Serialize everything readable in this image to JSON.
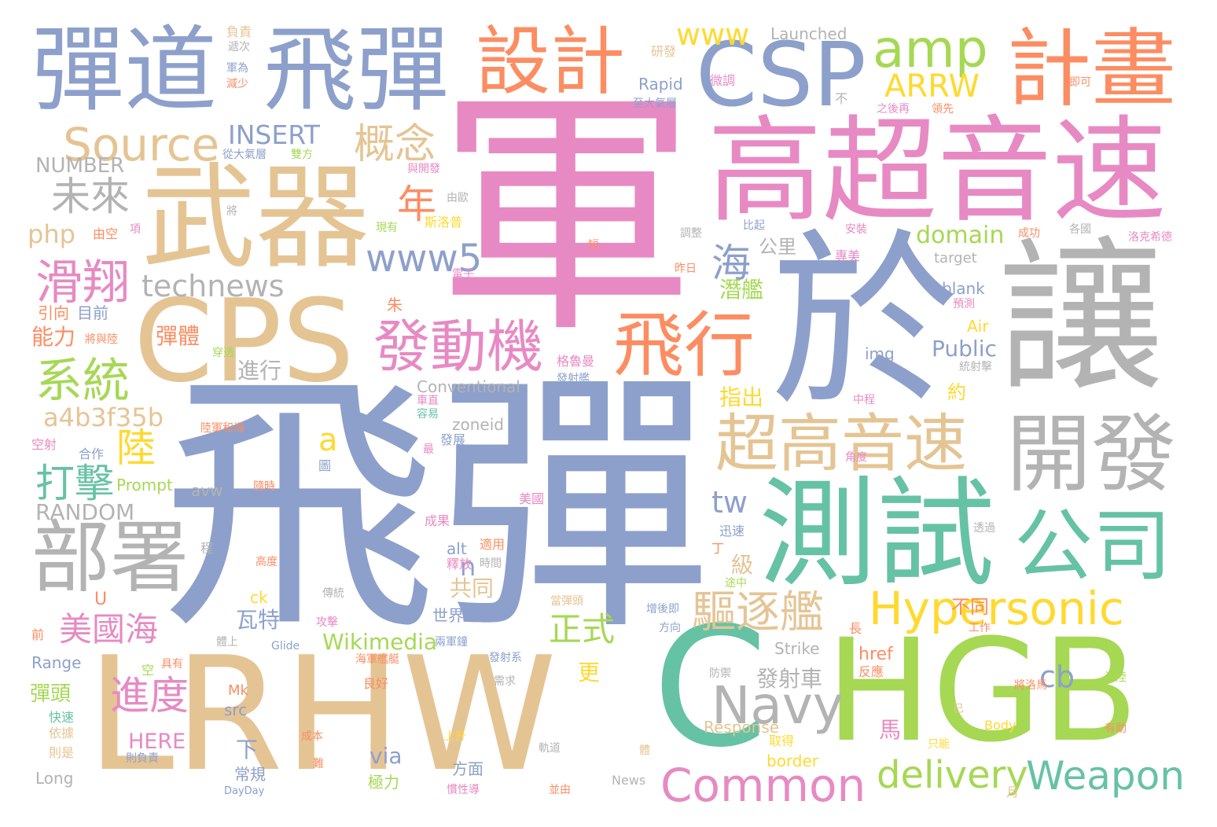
{
  "palette": {
    "blue": "#8da0cb",
    "pink": "#e78ac3",
    "green": "#a6d854",
    "orange": "#fc8d62",
    "tan": "#e5c494",
    "gray": "#b3b3b3",
    "teal": "#66c2a5",
    "yellow": "#ffd92f"
  },
  "words": [
    {
      "id": "w01",
      "text": "軍",
      "color": "pink"
    },
    {
      "id": "w02",
      "text": "飛彈",
      "color": "blue"
    },
    {
      "id": "w03",
      "text": "LRHW",
      "color": "tan"
    },
    {
      "id": "w04",
      "text": "C",
      "color": "teal"
    },
    {
      "id": "w05",
      "text": "HGB",
      "color": "green"
    },
    {
      "id": "w06",
      "text": "讓",
      "color": "gray"
    },
    {
      "id": "w07",
      "text": "於",
      "color": "blue"
    },
    {
      "id": "w08",
      "text": "高超音速",
      "color": "pink"
    },
    {
      "id": "w09",
      "text": "武器",
      "color": "tan"
    },
    {
      "id": "w10",
      "text": "CPS",
      "color": "tan"
    },
    {
      "id": "w11",
      "text": "測試",
      "color": "teal"
    },
    {
      "id": "w12",
      "text": "飛彈",
      "color": "blue"
    },
    {
      "id": "w13",
      "text": "彈道",
      "color": "blue"
    },
    {
      "id": "w14",
      "text": "CSP",
      "color": "blue"
    },
    {
      "id": "w15",
      "text": "計畫",
      "color": "orange"
    },
    {
      "id": "w16",
      "text": "設計",
      "color": "orange"
    },
    {
      "id": "w17",
      "text": "開發",
      "color": "gray"
    },
    {
      "id": "w18",
      "text": "部署",
      "color": "gray"
    },
    {
      "id": "w19",
      "text": "超高音速",
      "color": "tan"
    },
    {
      "id": "w20",
      "text": "公司",
      "color": "teal"
    },
    {
      "id": "w21",
      "text": "飛行",
      "color": "orange"
    },
    {
      "id": "w22",
      "text": "發動機",
      "color": "pink"
    },
    {
      "id": "w23",
      "text": "amp",
      "color": "green"
    },
    {
      "id": "w24",
      "text": "Navy",
      "color": "gray"
    },
    {
      "id": "w25",
      "text": "Hypersonic",
      "color": "yellow"
    },
    {
      "id": "w26",
      "text": "Common",
      "color": "pink"
    },
    {
      "id": "w27",
      "text": "Weapon",
      "color": "teal"
    },
    {
      "id": "w28",
      "text": "delivery",
      "color": "green"
    },
    {
      "id": "w29",
      "text": "Source",
      "color": "tan"
    },
    {
      "id": "w30",
      "text": "滑翔",
      "color": "pink"
    },
    {
      "id": "w31",
      "text": "系統",
      "color": "green"
    },
    {
      "id": "w32",
      "text": "驅逐艦",
      "color": "tan"
    },
    {
      "id": "w33",
      "text": "概念",
      "color": "tan"
    },
    {
      "id": "w34",
      "text": "未來",
      "color": "gray"
    },
    {
      "id": "w35",
      "text": "www5",
      "color": "blue"
    },
    {
      "id": "w36",
      "text": "ARRW",
      "color": "yellow"
    },
    {
      "id": "w37",
      "text": "www",
      "color": "yellow"
    },
    {
      "id": "w38",
      "text": "technews",
      "color": "gray"
    },
    {
      "id": "w39",
      "text": "INSERT",
      "color": "blue"
    },
    {
      "id": "w40",
      "text": "NUMBER",
      "color": "gray"
    },
    {
      "id": "w41",
      "text": "RANDOM",
      "color": "gray"
    },
    {
      "id": "w42",
      "text": "php",
      "color": "tan"
    },
    {
      "id": "w43",
      "text": "a4b3f35b",
      "color": "tan"
    },
    {
      "id": "w44",
      "text": "年",
      "color": "orange"
    },
    {
      "id": "w45",
      "text": "海",
      "color": "blue"
    },
    {
      "id": "w46",
      "text": "陸",
      "color": "yellow"
    },
    {
      "id": "w47",
      "text": "打擊",
      "color": "teal"
    },
    {
      "id": "w48",
      "text": "美國海",
      "color": "pink"
    },
    {
      "id": "w49",
      "text": "進度",
      "color": "pink"
    },
    {
      "id": "w50",
      "text": "正式",
      "color": "green"
    },
    {
      "id": "w51",
      "text": "domain",
      "color": "green"
    },
    {
      "id": "w52",
      "text": "tw",
      "color": "blue"
    },
    {
      "id": "w53",
      "text": "cb",
      "color": "blue"
    },
    {
      "id": "w54",
      "text": "Wikimedia",
      "color": "green"
    },
    {
      "id": "w55",
      "text": "Public",
      "color": "blue"
    },
    {
      "id": "w56",
      "text": "a",
      "color": "yellow"
    },
    {
      "id": "w57",
      "text": "n",
      "color": "blue"
    },
    {
      "id": "w58",
      "text": "via",
      "color": "blue"
    },
    {
      "id": "w59",
      "text": "HERE",
      "color": "pink"
    },
    {
      "id": "w60",
      "text": "Conventional",
      "color": "gray"
    },
    {
      "id": "w61",
      "text": "zoneid",
      "color": "gray"
    },
    {
      "id": "w62",
      "text": "Prompt",
      "color": "green"
    },
    {
      "id": "w63",
      "text": "Launched",
      "color": "gray"
    },
    {
      "id": "w64",
      "text": "Rapid",
      "color": "blue"
    },
    {
      "id": "w65",
      "text": "指出",
      "color": "yellow"
    },
    {
      "id": "w66",
      "text": "潛艦",
      "color": "green"
    },
    {
      "id": "w67",
      "text": "公里",
      "color": "gray"
    },
    {
      "id": "w68",
      "text": "發射車",
      "color": "gray"
    },
    {
      "id": "w69",
      "text": "瓦特",
      "color": "blue"
    },
    {
      "id": "w70",
      "text": "共同",
      "color": "tan"
    },
    {
      "id": "w71",
      "text": "級",
      "color": "tan"
    },
    {
      "id": "w72",
      "text": "彈體",
      "color": "orange"
    },
    {
      "id": "w73",
      "text": "能力",
      "color": "orange"
    },
    {
      "id": "w74",
      "text": "進行",
      "color": "gray"
    },
    {
      "id": "w75",
      "text": "更",
      "color": "yellow"
    },
    {
      "id": "w76",
      "text": "下",
      "color": "blue"
    },
    {
      "id": "w77",
      "text": "馬",
      "color": "pink"
    },
    {
      "id": "w78",
      "text": "不同",
      "color": "orange"
    },
    {
      "id": "w79",
      "text": "彈頭",
      "color": "green"
    },
    {
      "id": "w80",
      "text": "目前",
      "color": "blue"
    },
    {
      "id": "w81",
      "text": "引向",
      "color": "orange"
    },
    {
      "id": "w82",
      "text": "世界",
      "color": "blue"
    },
    {
      "id": "w83",
      "text": "方面",
      "color": "blue"
    },
    {
      "id": "w84",
      "text": "極力",
      "color": "green"
    },
    {
      "id": "w85",
      "text": "src",
      "color": "blue"
    },
    {
      "id": "w86",
      "text": "Mk",
      "color": "orange"
    },
    {
      "id": "w87",
      "text": "border",
      "color": "yellow"
    },
    {
      "id": "w88",
      "text": "href",
      "color": "orange"
    },
    {
      "id": "w89",
      "text": "Strike",
      "color": "gray"
    },
    {
      "id": "w90",
      "text": "Response",
      "color": "tan"
    },
    {
      "id": "w91",
      "text": "Body",
      "color": "yellow"
    },
    {
      "id": "w92",
      "text": "News",
      "color": "gray"
    },
    {
      "id": "w93",
      "text": "Long",
      "color": "gray"
    },
    {
      "id": "w94",
      "text": "Range",
      "color": "blue"
    },
    {
      "id": "w95",
      "text": "Glide",
      "color": "blue"
    },
    {
      "id": "w96",
      "text": "avw",
      "color": "gray"
    },
    {
      "id": "w97",
      "text": "alt",
      "color": "blue"
    },
    {
      "id": "w98",
      "text": "ck",
      "color": "yellow"
    },
    {
      "id": "w99",
      "text": "U",
      "color": "orange"
    },
    {
      "id": "w100",
      "text": "img",
      "color": "blue"
    },
    {
      "id": "w101",
      "text": "Air",
      "color": "yellow"
    },
    {
      "id": "w102",
      "text": "blank",
      "color": "blue"
    },
    {
      "id": "w103",
      "text": "target",
      "color": "gray"
    },
    {
      "id": "w104",
      "text": "DayDay",
      "color": "blue"
    },
    {
      "id": "w105",
      "text": "朱",
      "color": "orange"
    },
    {
      "id": "w106",
      "text": "約",
      "color": "yellow"
    },
    {
      "id": "w107",
      "text": "常規",
      "color": "blue"
    },
    {
      "id": "w108",
      "text": "月",
      "color": "tan"
    },
    {
      "id": "w109",
      "text": "負責",
      "color": "tan"
    },
    {
      "id": "w110",
      "text": "遞次",
      "color": "gray"
    },
    {
      "id": "w111",
      "text": "軍為",
      "color": "blue"
    },
    {
      "id": "w112",
      "text": "減少",
      "color": "orange"
    },
    {
      "id": "w113",
      "text": "研發",
      "color": "tan"
    },
    {
      "id": "w114",
      "text": "微調",
      "color": "pink"
    },
    {
      "id": "w115",
      "text": "即可",
      "color": "orange"
    },
    {
      "id": "w116",
      "text": "至大氣層",
      "color": "blue"
    },
    {
      "id": "w117",
      "text": "之後再",
      "color": "pink"
    },
    {
      "id": "w118",
      "text": "領先",
      "color": "orange"
    },
    {
      "id": "w119",
      "text": "不",
      "color": "gray"
    },
    {
      "id": "w120",
      "text": "從大氣層",
      "color": "blue"
    },
    {
      "id": "w121",
      "text": "雙方",
      "color": "green"
    },
    {
      "id": "w122",
      "text": "與開發",
      "color": "pink"
    },
    {
      "id": "w123",
      "text": "由歐",
      "color": "gray"
    },
    {
      "id": "w124",
      "text": "將",
      "color": "gray"
    },
    {
      "id": "w125",
      "text": "斯洛普",
      "color": "yellow"
    },
    {
      "id": "w126",
      "text": "現有",
      "color": "green"
    },
    {
      "id": "w127",
      "text": "由空",
      "color": "orange"
    },
    {
      "id": "w128",
      "text": "項",
      "color": "pink"
    },
    {
      "id": "w129",
      "text": "比起",
      "color": "blue"
    },
    {
      "id": "w130",
      "text": "調整",
      "color": "gray"
    },
    {
      "id": "w131",
      "text": "安裝",
      "color": "pink"
    },
    {
      "id": "w132",
      "text": "成功",
      "color": "orange"
    },
    {
      "id": "w133",
      "text": "各國",
      "color": "gray"
    },
    {
      "id": "w134",
      "text": "洛克希德",
      "color": "pink"
    },
    {
      "id": "w135",
      "text": "專美",
      "color": "pink"
    },
    {
      "id": "w136",
      "text": "昨日",
      "color": "orange"
    },
    {
      "id": "w137",
      "text": "短",
      "color": "orange"
    },
    {
      "id": "w138",
      "text": "電子",
      "color": "pink"
    },
    {
      "id": "w139",
      "text": "預測",
      "color": "pink"
    },
    {
      "id": "w140",
      "text": "將與陸",
      "color": "orange"
    },
    {
      "id": "w141",
      "text": "穿透",
      "color": "green"
    },
    {
      "id": "w142",
      "text": "格魯曼",
      "color": "pink"
    },
    {
      "id": "w143",
      "text": "發射艦",
      "color": "blue"
    },
    {
      "id": "w144",
      "text": "統射擊",
      "color": "gray"
    },
    {
      "id": "w145",
      "text": "車直",
      "color": "pink"
    },
    {
      "id": "w146",
      "text": "容易",
      "color": "teal"
    },
    {
      "id": "w147",
      "text": "中程",
      "color": "pink"
    },
    {
      "id": "w148",
      "text": "陸軍和海",
      "color": "orange"
    },
    {
      "id": "w149",
      "text": "空射",
      "color": "pink"
    },
    {
      "id": "w150",
      "text": "合作",
      "color": "blue"
    },
    {
      "id": "w151",
      "text": "圖",
      "color": "blue"
    },
    {
      "id": "w152",
      "text": "發展",
      "color": "blue"
    },
    {
      "id": "w153",
      "text": "最",
      "color": "pink"
    },
    {
      "id": "w154",
      "text": "隨時",
      "color": "orange"
    },
    {
      "id": "w155",
      "text": "角度",
      "color": "pink"
    },
    {
      "id": "w156",
      "text": "美國",
      "color": "pink"
    },
    {
      "id": "w157",
      "text": "成果",
      "color": "pink"
    },
    {
      "id": "w158",
      "text": "適用",
      "color": "orange"
    },
    {
      "id": "w159",
      "text": "釋放",
      "color": "pink"
    },
    {
      "id": "w160",
      "text": "時間",
      "color": "gray"
    },
    {
      "id": "w161",
      "text": "迅速",
      "color": "blue"
    },
    {
      "id": "w162",
      "text": "丁",
      "color": "orange"
    },
    {
      "id": "w163",
      "text": "透過",
      "color": "gray"
    },
    {
      "id": "w164",
      "text": "程",
      "color": "gray"
    },
    {
      "id": "w165",
      "text": "高度",
      "color": "orange"
    },
    {
      "id": "w166",
      "text": "途中",
      "color": "green"
    },
    {
      "id": "w167",
      "text": "傳統",
      "color": "gray"
    },
    {
      "id": "w168",
      "text": "當彈頭",
      "color": "tan"
    },
    {
      "id": "w169",
      "text": "增後即",
      "color": "blue"
    },
    {
      "id": "w170",
      "text": "攻擊",
      "color": "pink"
    },
    {
      "id": "w171",
      "text": "方向",
      "color": "blue"
    },
    {
      "id": "w172",
      "text": "長",
      "color": "orange"
    },
    {
      "id": "w173",
      "text": "工作",
      "color": "orange"
    },
    {
      "id": "w174",
      "text": "前",
      "color": "orange"
    },
    {
      "id": "w175",
      "text": "兩軍鐘",
      "color": "blue"
    },
    {
      "id": "w176",
      "text": "體上",
      "color": "gray"
    },
    {
      "id": "w177",
      "text": "海軍艦艇",
      "color": "orange"
    },
    {
      "id": "w178",
      "text": "發射系",
      "color": "blue"
    },
    {
      "id": "w179",
      "text": "反應",
      "color": "orange"
    },
    {
      "id": "w180",
      "text": "空",
      "color": "green"
    },
    {
      "id": "w181",
      "text": "具有",
      "color": "orange"
    },
    {
      "id": "w182",
      "text": "良好",
      "color": "orange"
    },
    {
      "id": "w183",
      "text": "防禦",
      "color": "gray"
    },
    {
      "id": "w184",
      "text": "需求",
      "color": "gray"
    },
    {
      "id": "w185",
      "text": "將洛馬",
      "color": "orange"
    },
    {
      "id": "w186",
      "text": "海陸",
      "color": "green"
    },
    {
      "id": "w187",
      "text": "快速",
      "color": "teal"
    },
    {
      "id": "w188",
      "text": "依據",
      "color": "tan"
    },
    {
      "id": "w189",
      "text": "則是",
      "color": "tan"
    },
    {
      "id": "w190",
      "text": "則負責",
      "color": "blue"
    },
    {
      "id": "w191",
      "text": "成本",
      "color": "orange"
    },
    {
      "id": "w192",
      "text": "上升",
      "color": "yellow"
    },
    {
      "id": "w193",
      "text": "取得",
      "color": "yellow"
    },
    {
      "id": "w194",
      "text": "已",
      "color": "tan"
    },
    {
      "id": "w195",
      "text": "只能",
      "color": "yellow"
    },
    {
      "id": "w196",
      "text": "有助",
      "color": "orange"
    },
    {
      "id": "w197",
      "text": "軌道",
      "color": "gray"
    },
    {
      "id": "w198",
      "text": "體",
      "color": "tan"
    },
    {
      "id": "w199",
      "text": "難",
      "color": "orange"
    },
    {
      "id": "w200",
      "text": "慣性導",
      "color": "pink"
    },
    {
      "id": "w201",
      "text": "並由",
      "color": "orange"
    }
  ]
}
